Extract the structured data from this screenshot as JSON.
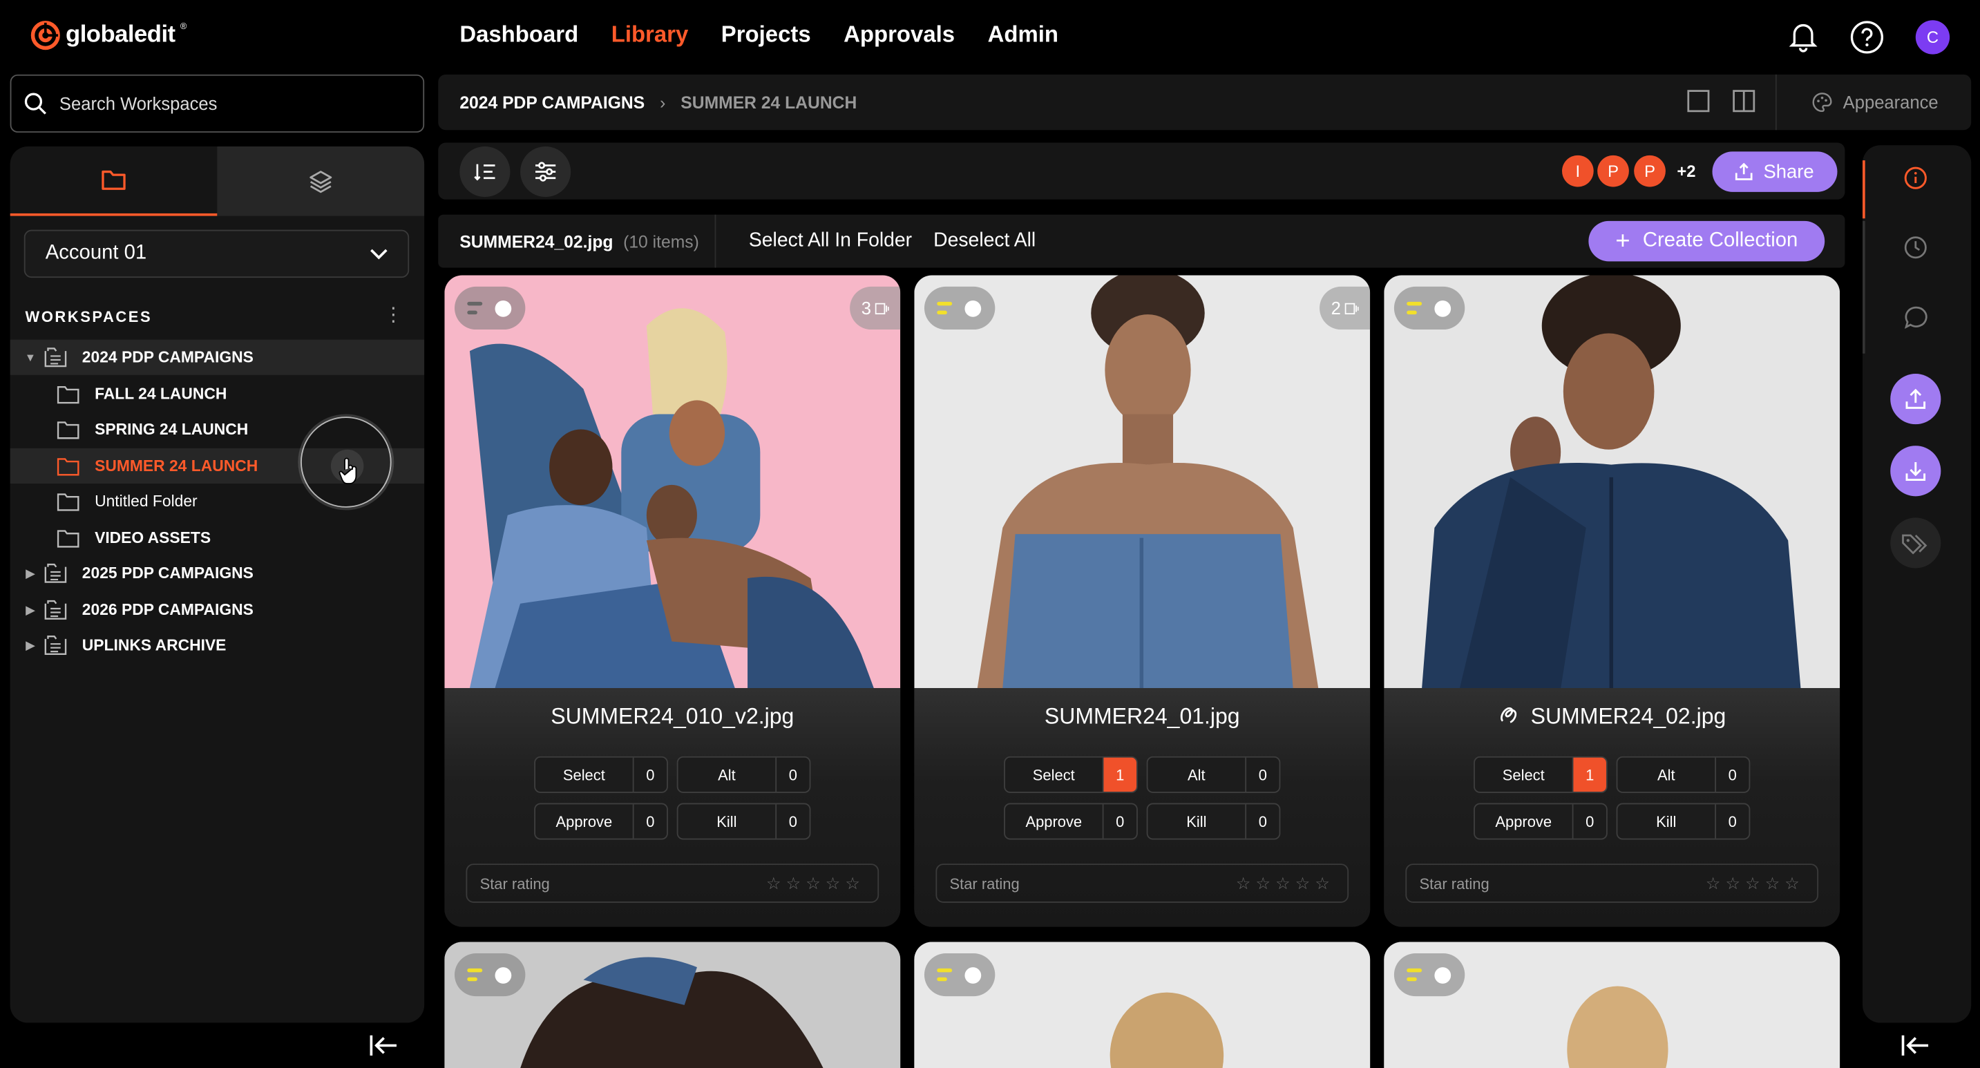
{
  "header": {
    "logo": "globaledit",
    "logo_reg": "®",
    "nav": [
      {
        "label": "Dashboard",
        "active": false
      },
      {
        "label": "Library",
        "active": true
      },
      {
        "label": "Projects",
        "active": false
      },
      {
        "label": "Approvals",
        "active": false
      },
      {
        "label": "Admin",
        "active": false
      }
    ],
    "user_initial": "C",
    "accent": "#ff5a2a",
    "purple": "#a07bf1"
  },
  "sidebar": {
    "search_placeholder": "Search Workspaces",
    "account": "Account 01",
    "workspaces_label": "WORKSPACES",
    "tree": [
      {
        "label": "2024 PDP CAMPAIGNS",
        "level": 0,
        "expanded": true
      },
      {
        "label": "FALL 24 LAUNCH",
        "level": 1
      },
      {
        "label": "SPRING 24 LAUNCH",
        "level": 1
      },
      {
        "label": "SUMMER 24 LAUNCH",
        "level": 1,
        "selected": true
      },
      {
        "label": "Untitled Folder",
        "level": 1
      },
      {
        "label": "VIDEO ASSETS",
        "level": 1
      },
      {
        "label": "2025 PDP CAMPAIGNS",
        "level": 0,
        "expanded": false
      },
      {
        "label": "2026 PDP CAMPAIGNS",
        "level": 0,
        "expanded": false
      },
      {
        "label": "UPLINKS ARCHIVE",
        "level": 0,
        "expanded": false
      }
    ]
  },
  "breadcrumb": {
    "root": "2024 PDP CAMPAIGNS",
    "current": "SUMMER 24 LAUNCH",
    "appearance": "Appearance"
  },
  "toolbar": {
    "collaborators": [
      "I",
      "P",
      "P"
    ],
    "more": "+2",
    "share": "Share"
  },
  "selection": {
    "file": "SUMMER24_02.jpg",
    "count": "(10 items)",
    "select_all": "Select All In Folder",
    "deselect_all": "Deselect All",
    "create_collection": "Create Collection"
  },
  "cards": [
    {
      "title": "SUMMER24_010_v2.jpg",
      "versions": "3",
      "select": "Select",
      "select_n": "0",
      "alt": "Alt",
      "alt_n": "0",
      "approve": "Approve",
      "approve_n": "0",
      "kill": "Kill",
      "kill_n": "0",
      "rating": "Star rating"
    },
    {
      "title": "SUMMER24_01.jpg",
      "versions": "2",
      "select": "Select",
      "select_n": "1",
      "alt": "Alt",
      "alt_n": "0",
      "approve": "Approve",
      "approve_n": "0",
      "kill": "Kill",
      "kill_n": "0",
      "rating": "Star rating"
    },
    {
      "title": "SUMMER24_02.jpg",
      "versions": "",
      "select": "Select",
      "select_n": "1",
      "alt": "Alt",
      "alt_n": "0",
      "approve": "Approve",
      "approve_n": "0",
      "kill": "Kill",
      "kill_n": "0",
      "rating": "Star rating"
    }
  ]
}
